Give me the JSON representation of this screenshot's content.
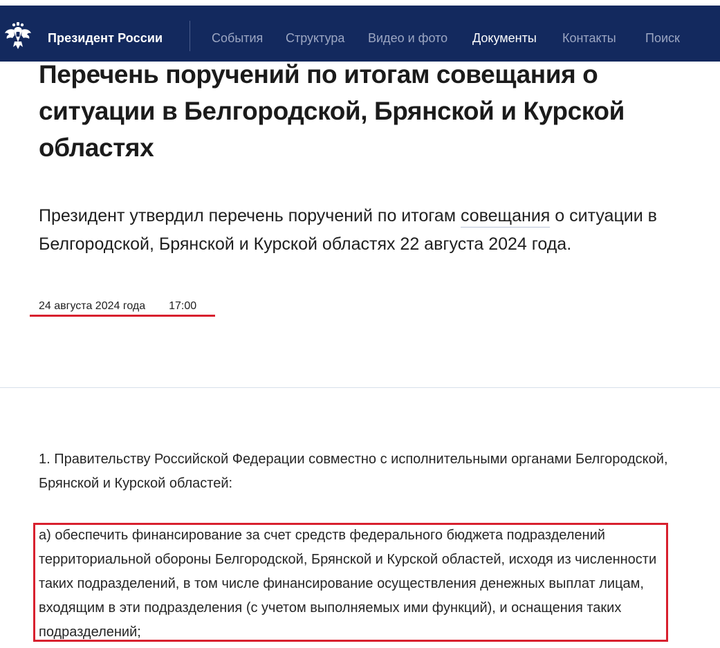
{
  "header": {
    "brand": "Президент России",
    "nav": [
      {
        "label": "События",
        "active": false
      },
      {
        "label": "Структура",
        "active": false
      },
      {
        "label": "Видео и фото",
        "active": false
      },
      {
        "label": "Документы",
        "active": true
      },
      {
        "label": "Контакты",
        "active": false
      },
      {
        "label": "Поиск",
        "active": false
      }
    ],
    "logo_icon": "double-headed-eagle-emblem",
    "background_color": "#13295e"
  },
  "article": {
    "title": "Перечень поручений по итогам совещания о ситуации в Белгородской, Брянской и Курской областях",
    "lead_before": "Президент утвердил перечень поручений по итогам ",
    "lead_link": "совещания",
    "lead_after": " о ситуации в Белгородской, Брянской и Курской областях 22 августа 2024 года.",
    "date": "24 августа 2024 года",
    "time": "17:00",
    "paragraphs": [
      "1. Правительству Российской Федерации совместно с исполнительными органами Белгородской, Брянской и Курской областей:",
      "а) обеспечить финансирование за счет средств федерального бюджета подразделений территориальной обороны Белгородской, Брянской и Курской областей, исходя из численности таких подразделений, в том числе финансирование осуществления денежных выплат лицам, входящим в эти подразделения (с учетом выполняемых ими функций), и оснащения таких подразделений;"
    ]
  },
  "annotation_color": "#d8202e"
}
